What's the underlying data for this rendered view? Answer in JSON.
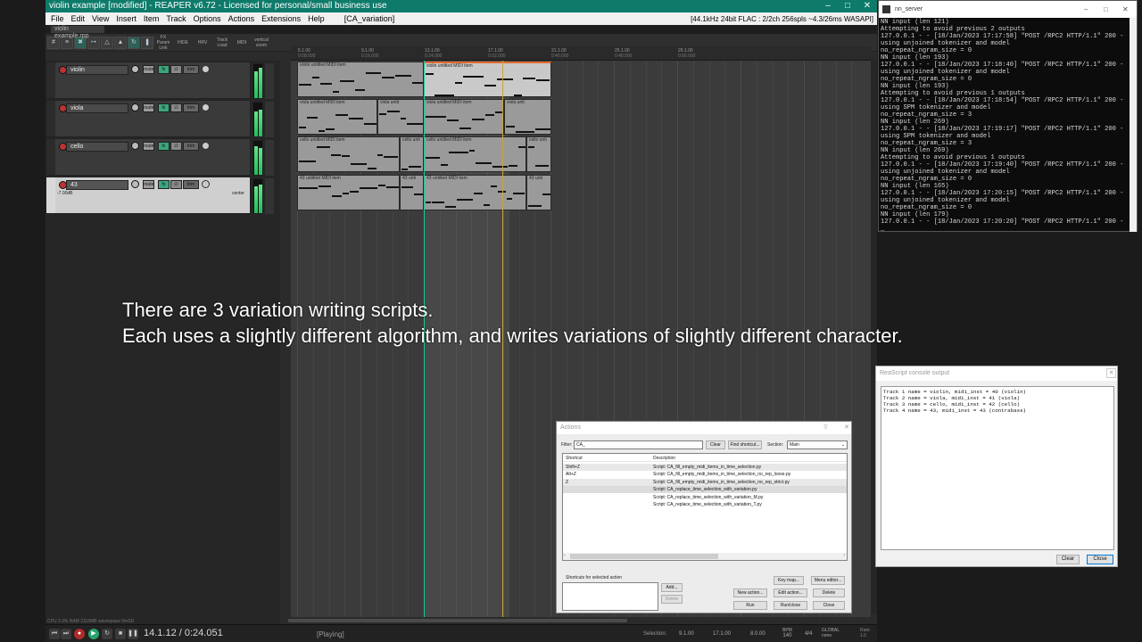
{
  "reaper": {
    "title": "violin example [modified] - REAPER v6.72 - Licensed for personal/small business use",
    "menu": [
      "File",
      "Edit",
      "View",
      "Insert",
      "Item",
      "Track",
      "Options",
      "Actions",
      "Extensions",
      "Help"
    ],
    "project_label": "[CA_variation]",
    "audio_info": "[44.1kHz 24bit FLAC : 2/2ch 256spls ~4.3/26ms WASAPI]",
    "project_tab": "violin example.rpp",
    "toolbar_text": [
      "FX Param Link",
      "HIDE",
      "HRV",
      "Track Load",
      "MIDI",
      "vertical zoom"
    ]
  },
  "tracks": [
    {
      "name": "violin",
      "buttons": {
        "route": "route",
        "fx": "fx",
        "io": "∅",
        "env": "trim"
      },
      "vol_readout": "",
      "pan_readout": "",
      "selected": false,
      "meter_l": 0.8,
      "meter_r": 0.9
    },
    {
      "name": "viola",
      "buttons": {
        "route": "route",
        "fx": "fx",
        "io": "∅",
        "env": "trim"
      },
      "vol_readout": "",
      "pan_readout": "",
      "selected": false,
      "meter_l": 0.75,
      "meter_r": 0.8
    },
    {
      "name": "cello",
      "buttons": {
        "route": "route",
        "fx": "fx",
        "io": "∅",
        "env": "trim"
      },
      "vol_readout": "",
      "pan_readout": "",
      "selected": false,
      "meter_l": 0.85,
      "meter_r": 0.8
    },
    {
      "name": "43",
      "buttons": {
        "route": "route",
        "fx": "fx",
        "io": "∅",
        "env": "trim"
      },
      "vol_readout": "-7.00dB",
      "pan_readout": "center",
      "selected": true,
      "meter_l": 0.8,
      "meter_r": 0.85
    }
  ],
  "ruler": [
    {
      "bar": "5.1.00",
      "time": "0:08.000"
    },
    {
      "bar": "9.1.00",
      "time": "0:16.000"
    },
    {
      "bar": "13.1.00",
      "time": "0:24.000"
    },
    {
      "bar": "17.1.00",
      "time": "0:32.000"
    },
    {
      "bar": "21.1.00",
      "time": "0:40.000"
    },
    {
      "bar": "25.1.00",
      "time": "0:48.000"
    },
    {
      "bar": "29.1.00",
      "time": "0:56.000"
    }
  ],
  "items": [
    {
      "title": "violin untitled MIDI item"
    },
    {
      "title": "violin untitled MIDI item"
    },
    {
      "title": "viola untitled MIDI item"
    },
    {
      "title": "viola untit"
    },
    {
      "title": "viola untitled MIDI item"
    },
    {
      "title": "viola unti"
    },
    {
      "title": "cello untitled MIDI item"
    },
    {
      "title": "cello unti"
    },
    {
      "title": "cello untitled MIDI item"
    },
    {
      "title": "cello unti"
    },
    {
      "title": "43 untitled MIDI item"
    },
    {
      "title": "43 unti"
    },
    {
      "title": "43 untitled MIDI item"
    },
    {
      "title": "43 unti"
    }
  ],
  "transport": {
    "position": "14.1.12 / 0:24.051",
    "state": "[Playing]",
    "selection_label": "Selection:",
    "sel_start": "9.1.00",
    "sel_end": "17.1.00",
    "sel_len": "8.0.00",
    "bpm_label": "BPM",
    "bpm": "140",
    "timesig": "4/4",
    "global": "GLOBAL",
    "none": "none",
    "status_left": "CPU 3.3%  RAM 2115MB  wavespace 0mSD",
    "status_right": "Rate:\n1.0"
  },
  "caption": {
    "line1": "There are 3 variation writing scripts.",
    "line2": "Each uses a slightly different algorithm, and writes variations of slightly different character."
  },
  "console": {
    "title": "nn_server",
    "text": "NN input (len 121)\nAttempting to avoid previous 2 outputs\n127.0.0.1 - - [18/Jan/2023 17:17:58] \"POST /RPC2 HTTP/1.1\" 200 -\nusing unjoined tokenizer and model\nno_repeat_ngram_size = 0\nNN input (len 193)\n127.0.0.1 - - [18/Jan/2023 17:18:40] \"POST /RPC2 HTTP/1.1\" 200 -\nusing unjoined tokenizer and model\nno_repeat_ngram_size = 0\nNN input (len 193)\nAttempting to avoid previous 1 outputs\n127.0.0.1 - - [18/Jan/2023 17:18:54] \"POST /RPC2 HTTP/1.1\" 200 -\nusing SPM tokenizer and model\nno_repeat_ngram_size = 3\nNN input (len 269)\n127.0.0.1 - - [18/Jan/2023 17:19:17] \"POST /RPC2 HTTP/1.1\" 200 -\nusing SPM tokenizer and model\nno_repeat_ngram_size = 3\nNN input (len 269)\nAttempting to avoid previous 1 outputs\n127.0.0.1 - - [18/Jan/2023 17:19:40] \"POST /RPC2 HTTP/1.1\" 200 -\nusing unjoined tokenizer and model\nno_repeat_ngram_size = 0\nNN input (len 165)\n127.0.0.1 - - [18/Jan/2023 17:20:15] \"POST /RPC2 HTTP/1.1\" 200 -\nusing unjoined tokenizer and model\nno_repeat_ngram_size = 0\nNN input (len 179)\n127.0.0.1 - - [18/Jan/2023 17:20:20] \"POST /RPC2 HTTP/1.1\" 200 -\n_"
  },
  "reascript": {
    "title": "ReaScript console output",
    "output": "Track 1 name = violin, midi_inst = 40 (violin)\nTrack 2 name = viola, midi_inst = 41 (viola)\nTrack 3 name = cello, midi_inst = 42 (cello)\nTrack 4 name = 43, midi_inst = 43 (contrabass)",
    "clear": "Clear",
    "close": "Close"
  },
  "actions": {
    "title": "Actions",
    "filter_label": "Filter:",
    "filter_value": "CA_",
    "clear": "Clear",
    "find_shortcut": "Find shortcut...",
    "section_label": "Section:",
    "section_value": "Main",
    "col_shortcut": "Shortcut",
    "col_description": "Description",
    "rows": [
      {
        "shortcut": "Shift+Z",
        "description": "Script: CA_fill_empty_midi_items_in_time_selection.py"
      },
      {
        "shortcut": "Alt+Z",
        "description": "Script: CA_fill_empty_midi_items_in_time_selection_no_rep_loose.py"
      },
      {
        "shortcut": "Z",
        "description": "Script: CA_fill_empty_midi_items_in_time_selection_no_rep_strict.py"
      },
      {
        "shortcut": "",
        "description": "Script: CA_replace_time_selection_with_variation.py"
      },
      {
        "shortcut": "",
        "description": "Script: CA_replace_time_selection_with_variation_M.py"
      },
      {
        "shortcut": "",
        "description": "Script: CA_replace_time_selection_with_variation_T.py"
      }
    ],
    "shortcuts_label": "Shortcuts for selected action",
    "add": "Add...",
    "delete_shortcut": "Delete",
    "key_map": "Key map...",
    "menu_editor": "Menu editor...",
    "new_action": "New action...",
    "edit_action": "Edit action...",
    "delete": "Delete",
    "run": "Run",
    "run_close": "Run/close",
    "close": "Close"
  }
}
